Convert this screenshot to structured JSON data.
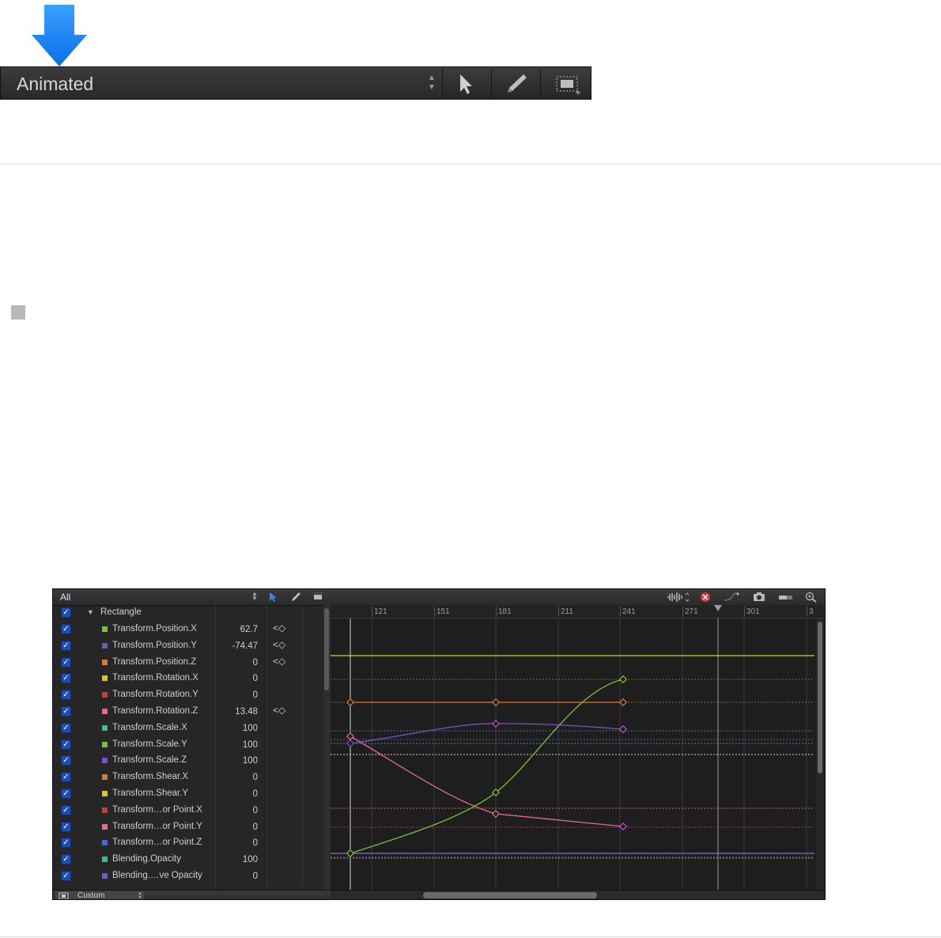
{
  "top_toolbar": {
    "popup_label": "Animated",
    "tools": [
      "select-tool",
      "pen-tool",
      "rect-select-tool"
    ]
  },
  "editor": {
    "left_header": {
      "label": "All"
    },
    "group": {
      "name": "Rectangle"
    },
    "rows": [
      {
        "name": "Transform.Position.X",
        "value": "62.7",
        "color": "#7bc13a",
        "keyframe": "<◇"
      },
      {
        "name": "Transform.Position.Y",
        "value": "-74.47",
        "color": "#7b52c9",
        "keyframe": "<◇"
      },
      {
        "name": "Transform.Position.Z",
        "value": "0",
        "color": "#e07a2a",
        "keyframe": "<◇"
      },
      {
        "name": "Transform.Rotation.X",
        "value": "0",
        "color": "#e2c12d",
        "keyframe": ""
      },
      {
        "name": "Transform.Rotation.Y",
        "value": "0",
        "color": "#d0383a",
        "keyframe": ""
      },
      {
        "name": "Transform.Rotation.Z",
        "value": "13.48",
        "color": "#e06a9a",
        "keyframe": "<◇"
      },
      {
        "name": "Transform.Scale.X",
        "value": "100",
        "color": "#2ec0a0",
        "keyframe": ""
      },
      {
        "name": "Transform.Scale.Y",
        "value": "100",
        "color": "#7bc13a",
        "keyframe": ""
      },
      {
        "name": "Transform.Scale.Z",
        "value": "100",
        "color": "#7b52c9",
        "keyframe": ""
      },
      {
        "name": "Transform.Shear.X",
        "value": "0",
        "color": "#e07a2a",
        "keyframe": ""
      },
      {
        "name": "Transform.Shear.Y",
        "value": "0",
        "color": "#e2c12d",
        "keyframe": ""
      },
      {
        "name": "Transform…or Point.X",
        "value": "0",
        "color": "#d0383a",
        "keyframe": ""
      },
      {
        "name": "Transform…or Point.Y",
        "value": "0",
        "color": "#e06a9a",
        "keyframe": ""
      },
      {
        "name": "Transform…or Point.Z",
        "value": "0",
        "color": "#3a6fd8",
        "keyframe": ""
      },
      {
        "name": "Blending.Opacity",
        "value": "100",
        "color": "#2ec0a0",
        "keyframe": ""
      },
      {
        "name": "Blending.…ve Opacity",
        "value": "0",
        "color": "#7b52c9",
        "keyframe": ""
      }
    ],
    "footer": {
      "label": "Custom"
    },
    "ruler_ticks": [
      "121",
      "151",
      "181",
      "211",
      "241",
      "271",
      "301",
      "3"
    ],
    "right_tools": [
      "waveform-icon",
      "clear-icon",
      "fit-curve-icon",
      "snapshot-icon",
      "toggle-icon",
      "zoom-icon"
    ]
  }
}
